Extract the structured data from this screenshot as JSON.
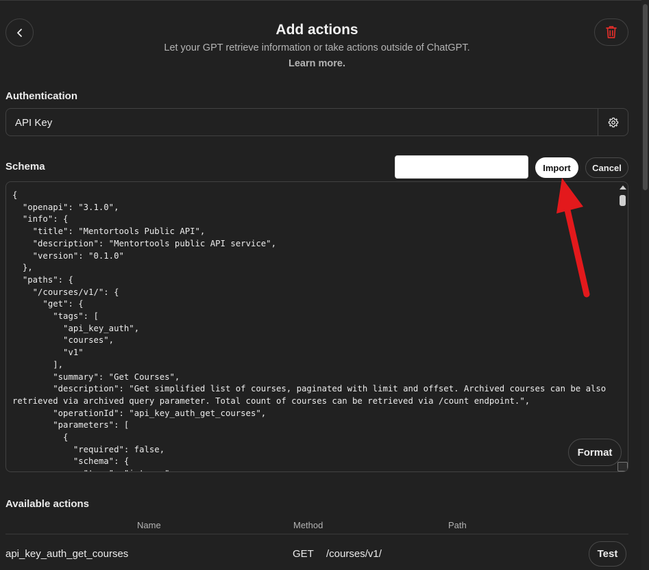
{
  "header": {
    "title": "Add actions",
    "subtitle": "Let your GPT retrieve information or take actions outside of ChatGPT.",
    "learn_more": "Learn more."
  },
  "authentication": {
    "label": "Authentication",
    "value": "API Key",
    "settings_icon": "gear-icon"
  },
  "schema": {
    "label": "Schema",
    "url_input_value": "",
    "import_label": "Import",
    "cancel_label": "Cancel",
    "format_label": "Format",
    "code": "{\n  \"openapi\": \"3.1.0\",\n  \"info\": {\n    \"title\": \"Mentortools Public API\",\n    \"description\": \"Mentortools public API service\",\n    \"version\": \"0.1.0\"\n  },\n  \"paths\": {\n    \"/courses/v1/\": {\n      \"get\": {\n        \"tags\": [\n          \"api_key_auth\",\n          \"courses\",\n          \"v1\"\n        ],\n        \"summary\": \"Get Courses\",\n        \"description\": \"Get simplified list of courses, paginated with limit and offset. Archived courses can be also retrieved via archived query parameter. Total count of courses can be retrieved via /count endpoint.\",\n        \"operationId\": \"api_key_auth_get_courses\",\n        \"parameters\": [\n          {\n            \"required\": false,\n            \"schema\": {\n              \"type\": \"integer\","
  },
  "available_actions": {
    "label": "Available actions",
    "columns": [
      "Name",
      "Method",
      "Path"
    ],
    "rows": [
      {
        "name": "api_key_auth_get_courses",
        "method": "GET",
        "path": "/courses/v1/",
        "test_label": "Test"
      }
    ]
  },
  "annotation": {
    "arrow_color": "#e3191c"
  },
  "icons": {
    "back": "chevron-left-icon",
    "delete": "trash-icon"
  },
  "colors": {
    "background": "#212121",
    "delete_red": "#e02e2a"
  }
}
